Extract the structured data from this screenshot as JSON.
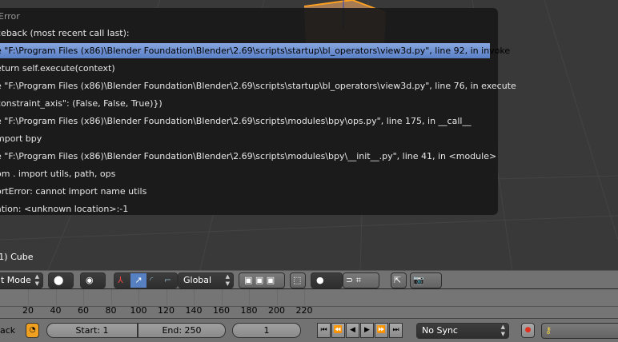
{
  "error_popup": {
    "title": "Error",
    "lines": [
      "ceback (most recent call last):",
      "e \"F:\\Program Files (x86)\\Blender Foundation\\Blender\\2.69\\scripts\\startup\\bl_operators\\view3d.py\", line 92, in invoke",
      "eturn self.execute(context)",
      "e \"F:\\Program Files (x86)\\Blender Foundation\\Blender\\2.69\\scripts\\startup\\bl_operators\\view3d.py\", line 76, in execute",
      "constraint_axis\": (False, False, True)})",
      "e \"F:\\Program Files (x86)\\Blender Foundation\\Blender\\2.69\\scripts\\modules\\bpy\\ops.py\", line 175, in __call__",
      "mport bpy",
      "e \"F:\\Program Files (x86)\\Blender Foundation\\Blender\\2.69\\scripts\\modules\\bpy\\__init__.py\", line 41, in <module>",
      "om . import utils, path, ops",
      "ortError: cannot import name utils",
      "ation: <unknown location>:-1"
    ],
    "selected_index": 1
  },
  "viewport": {
    "object_label": "(1) Cube"
  },
  "header3d": {
    "mode": "t Mode",
    "orientation": "Global"
  },
  "timeline": {
    "ticks": [
      "20",
      "40",
      "60",
      "80",
      "100",
      "120",
      "140",
      "160",
      "180",
      "200",
      "220"
    ]
  },
  "bottombar": {
    "menu": "ack",
    "start": "Start: 1",
    "end": "End: 250",
    "current_frame": "1",
    "sync": "No Sync"
  },
  "colors": {
    "selection": "#5a7fc6",
    "record": "#e03020"
  }
}
